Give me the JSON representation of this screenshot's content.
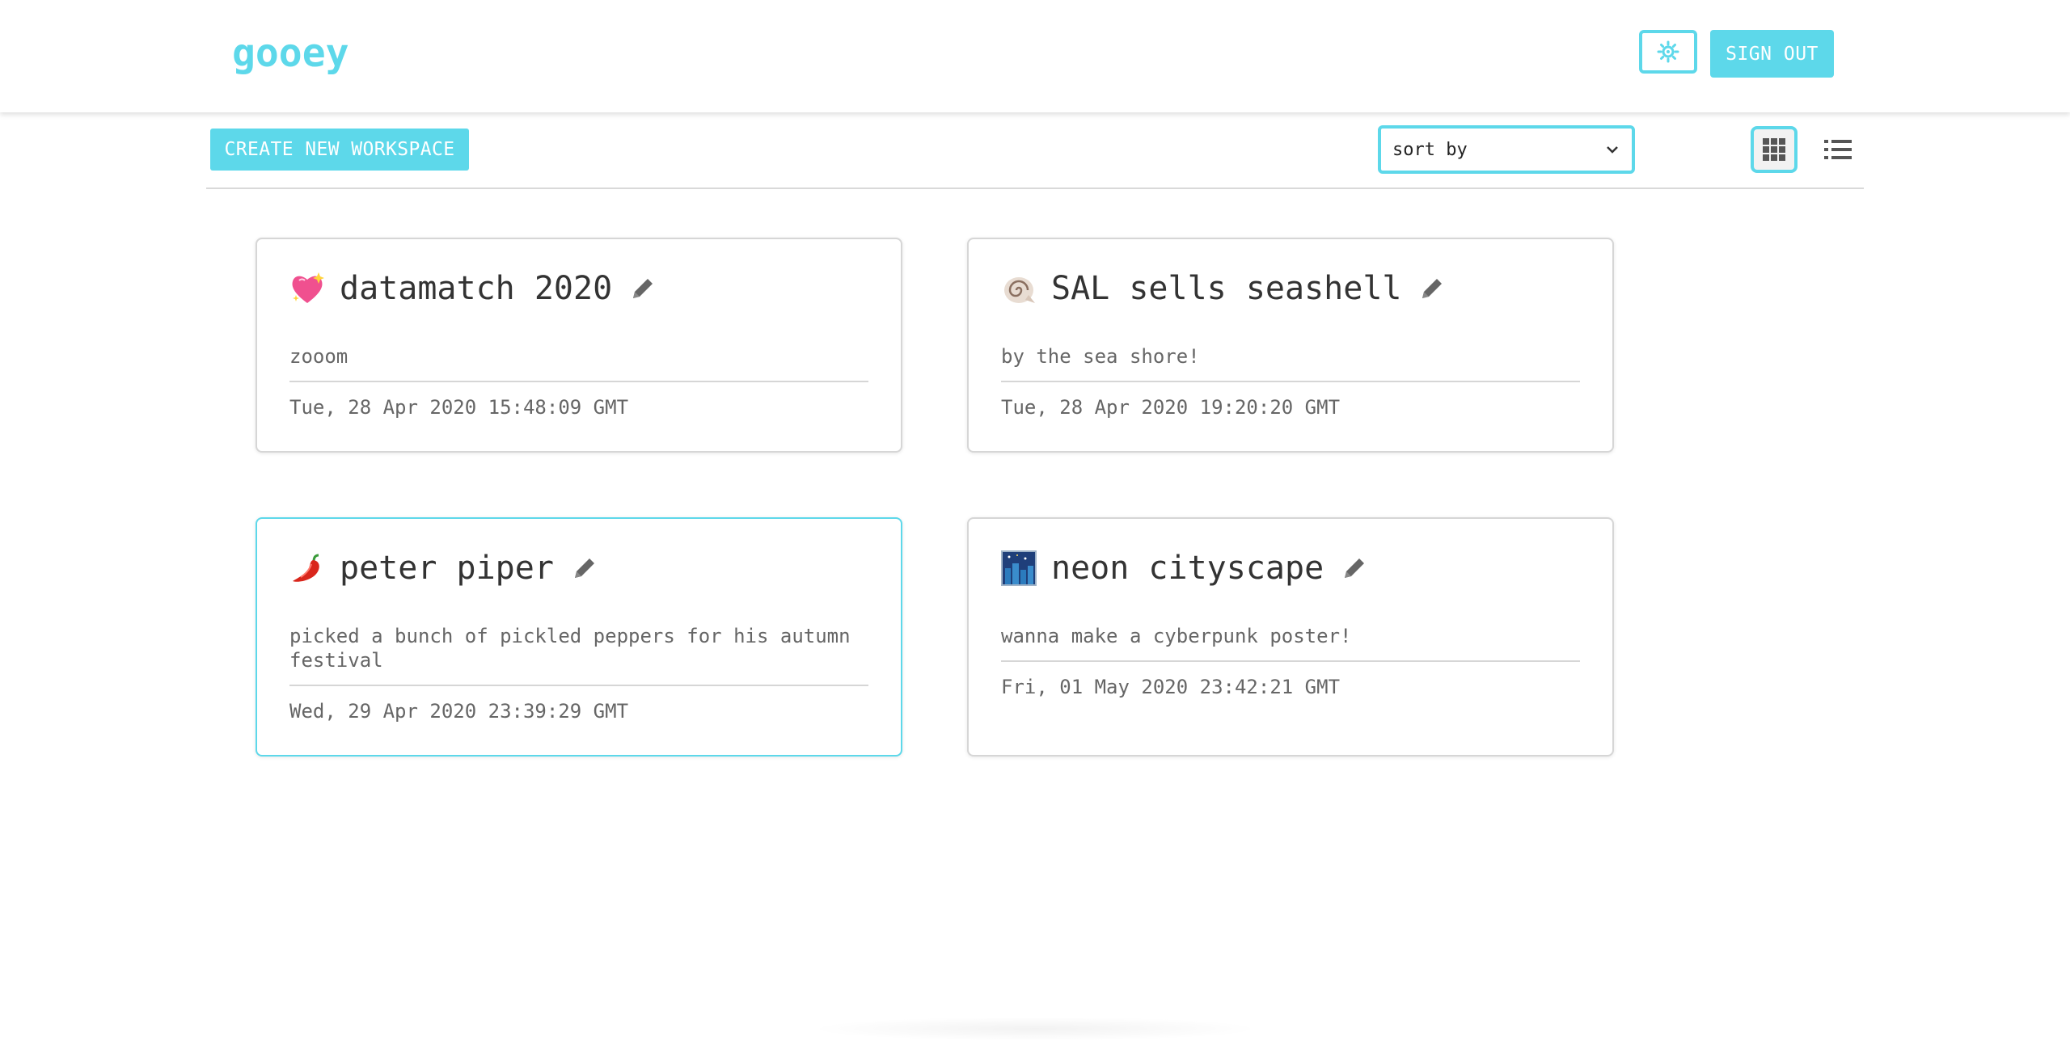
{
  "app": {
    "logo": "gooey"
  },
  "header": {
    "theme_icon": "sun-gear-icon",
    "signout_label": "SIGN OUT"
  },
  "toolbar": {
    "create_label": "CREATE NEW WORKSPACE",
    "sort_value": "sort by",
    "grid_view_icon": "grid-icon",
    "list_view_icon": "list-icon"
  },
  "colors": {
    "accent": "#5dd8ea",
    "text": "#333333",
    "muted": "#666666"
  },
  "workspaces": [
    {
      "emoji": "sparkling-heart",
      "title": "datamatch 2020",
      "description": "zooom",
      "date": "Tue, 28 Apr 2020 15:48:09 GMT"
    },
    {
      "emoji": "spiral-shell",
      "title": "SAL sells seashell",
      "description": "by the sea shore!",
      "date": "Tue, 28 Apr 2020 19:20:20 GMT"
    },
    {
      "emoji": "hot-pepper",
      "title": "peter piper",
      "description": "picked a bunch of pickled peppers for his autumn festival",
      "date": "Wed, 29 Apr 2020 23:39:29 GMT"
    },
    {
      "emoji": "night-with-stars",
      "title": "neon cityscape",
      "description": "wanna make a cyberpunk poster!",
      "date": "Fri, 01 May 2020 23:42:21 GMT"
    }
  ]
}
